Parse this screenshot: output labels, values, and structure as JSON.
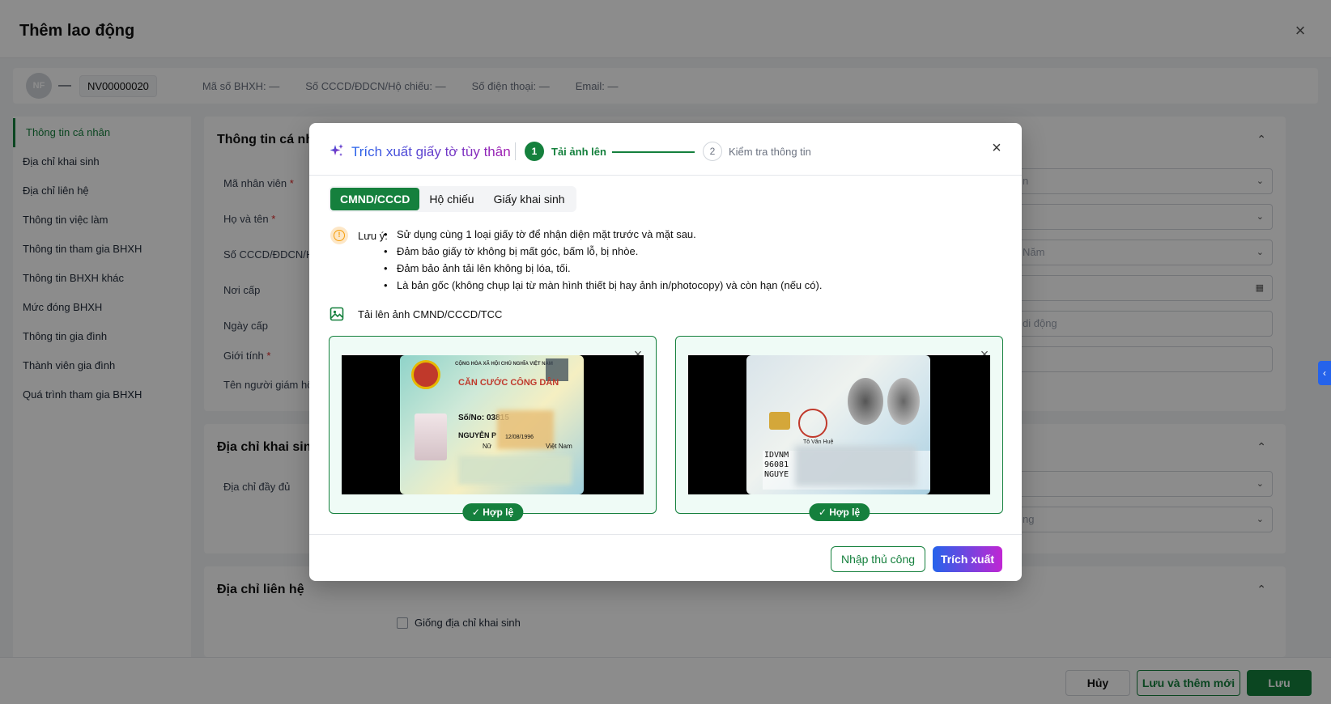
{
  "page": {
    "title": "Thêm lao động",
    "employee": {
      "avatar_initials": "NF",
      "name": "—",
      "code": "NV00000020",
      "bhxh": "Mã số BHXH: —",
      "id_no": "Số CCCD/ĐDCN/Hộ chiếu: —",
      "phone": "Số điện thoại: —",
      "email": "Email: —"
    },
    "nav": [
      "Thông tin cá nhân",
      "Địa chỉ khai sinh",
      "Địa chỉ liên hệ",
      "Thông tin việc làm",
      "Thông tin tham gia BHXH",
      "Thông tin BHXH khác",
      "Mức đóng BHXH",
      "Thông tin gia đình",
      "Thành viên gia đình",
      "Quá trình tham gia BHXH"
    ],
    "sections": {
      "personal": {
        "title": "Thông tin cá nhân",
        "fields": [
          "Mã nhân viên",
          "Họ và tên",
          "Số CCCD/ĐDCN/Hộ chiếu",
          "Nơi cấp",
          "Ngày cấp",
          "Giới tính",
          "Tên người giám hộ"
        ],
        "right_values": [
          "n",
          "",
          "Năm",
          "",
          "di động",
          ""
        ]
      },
      "birth_address": {
        "title": "Địa chỉ khai sinh",
        "field": "Địa chỉ đầy đủ",
        "right_value": "ng"
      },
      "contact_address": {
        "title": "Địa chỉ liên hệ",
        "checkbox": "Giống địa chỉ khai sinh"
      }
    },
    "footer": {
      "cancel": "Hủy",
      "save_new": "Lưu và thêm mới",
      "save": "Lưu"
    }
  },
  "modal": {
    "title": "Trích xuất giấy tờ tùy thân",
    "steps": [
      {
        "num": "1",
        "label": "Tải ảnh lên"
      },
      {
        "num": "2",
        "label": "Kiểm tra thông tin"
      }
    ],
    "tabs": [
      "CMND/CCCD",
      "Hộ chiếu",
      "Giấy khai sinh"
    ],
    "note_label": "Lưu ý:",
    "notes": [
      "Sử dụng cùng 1 loại giấy tờ để nhận diện mặt trước và mặt sau.",
      "Đảm bảo giấy tờ không bị mất góc, bấm lỗ, bị nhòe.",
      "Đảm bảo ảnh tải lên không bị lóa, tối.",
      "Là bản gốc (không chụp lại từ màn hình thiết bị hay ảnh in/photocopy) và còn hạn (nếu có)."
    ],
    "upload_label": "Tải lên ảnh CMND/CCCD/TCC",
    "cards": [
      {
        "badge": "✓ Hợp lệ",
        "lines": [
          "CỘNG HÒA XÃ HỘI CHỦ NGHĨA VIỆT NAM",
          "CĂN CƯỚC CÔNG DÂN",
          "Số/No: 03815",
          "NGUYỄN P",
          "Nữ",
          "Việt Nam",
          "12/08/1996"
        ]
      },
      {
        "badge": "✓ Hợp lệ",
        "lines": [
          "IDVNM",
          "96081",
          "NGUYE",
          "Tô Văn Huệ"
        ]
      }
    ],
    "btn_manual": "Nhập thủ công",
    "btn_extract": "Trích xuất"
  },
  "colors": {
    "primary": "#15803d",
    "accent_start": "#2563eb",
    "accent_end": "#c026d3"
  }
}
